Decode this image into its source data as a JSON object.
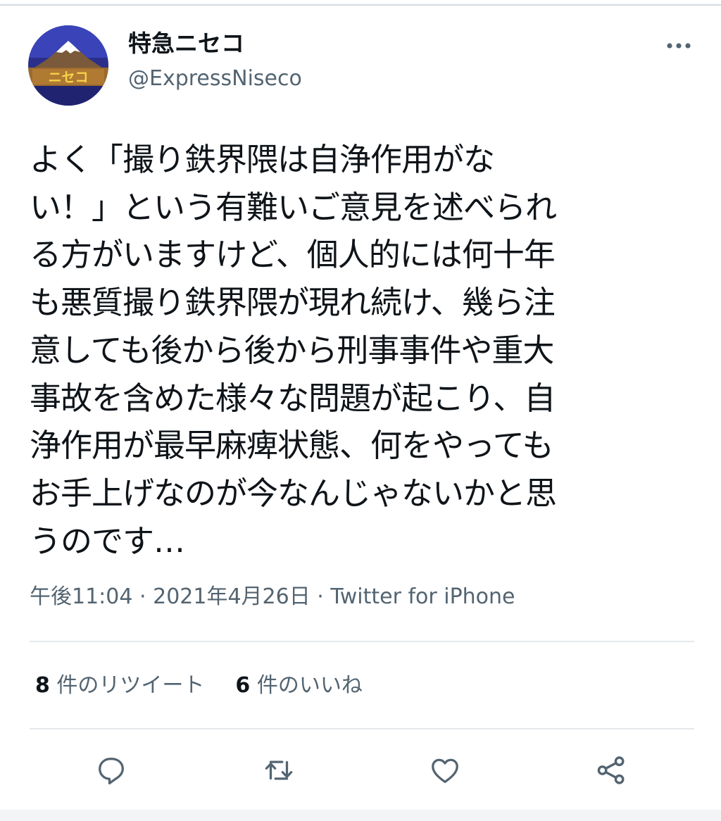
{
  "author": {
    "display_name": "特急ニセコ",
    "handle": "@ExpressNiseco",
    "avatar_text": "ニセコ"
  },
  "tweet": {
    "lines": [
      "よく「撮り鉄界隈は自浄作用がな",
      "い！」という有難いご意見を述べられ",
      "る方がいますけど、個人的には何十年",
      "も悪質撮り鉄界隈が現れ続け、幾ら注",
      "意しても後から後から刑事事件や重大",
      "事故を含めた様々な問題が起こり、自",
      "浄作用が最早麻痺状態、何をやっても",
      "お手上げなのが今なんじゃないかと思",
      "うのです…"
    ],
    "time": "午後11:04",
    "date": "2021年4月26日",
    "separator": "·",
    "source": "Twitter for iPhone"
  },
  "stats": {
    "retweets_count": "8",
    "retweets_label": "件のリツイート",
    "likes_count": "6",
    "likes_label": "件のいいね"
  },
  "actions": [
    "reply-icon",
    "retweet-icon",
    "like-icon",
    "share-icon"
  ],
  "colors": {
    "text": "#0f1419",
    "secondary": "#536471",
    "icon": "#536471",
    "divider": "#e4e8eb"
  }
}
